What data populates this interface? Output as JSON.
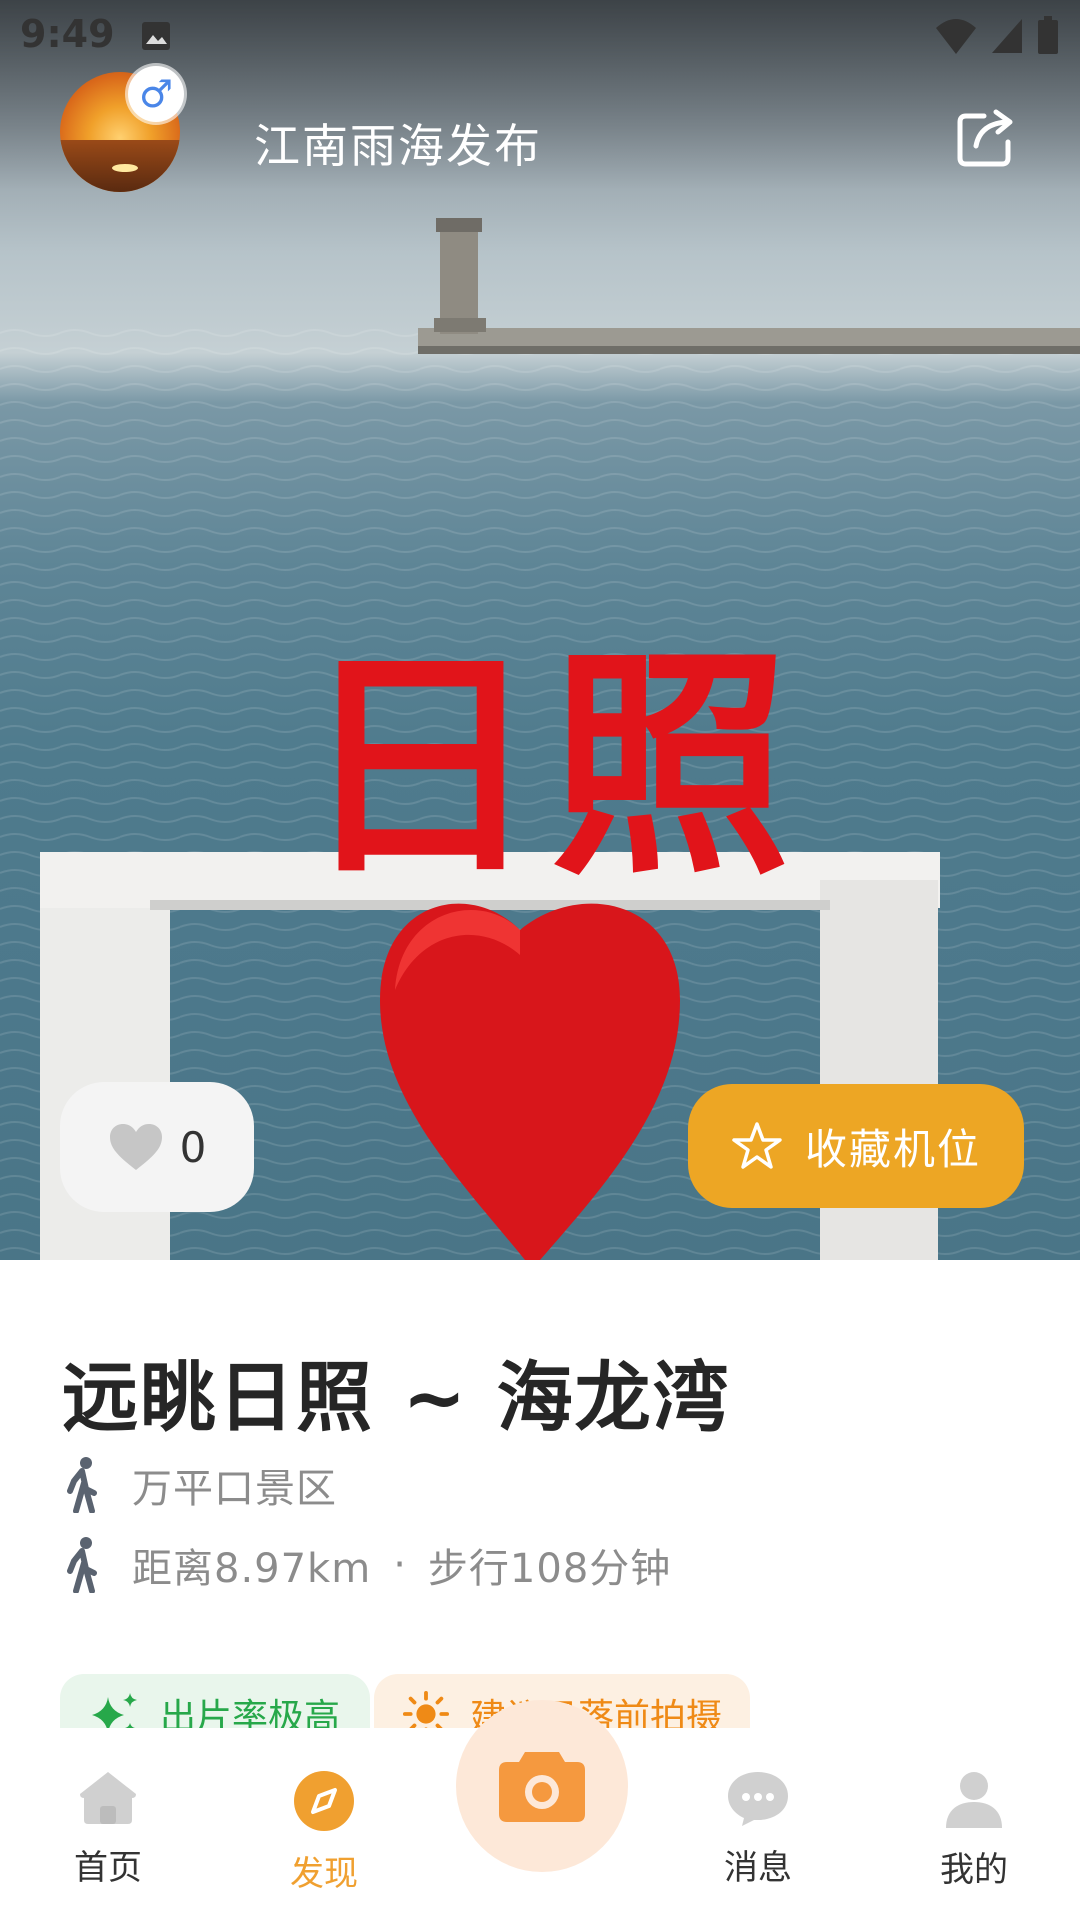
{
  "status_bar": {
    "time": "9:49"
  },
  "header": {
    "author_name": "江南雨海发布",
    "gender_symbol": "♂"
  },
  "photo": {
    "like_count": "0",
    "collect_label": "收藏机位",
    "sign_text": "日照"
  },
  "spot": {
    "title": "远眺日照 ~ 海龙湾",
    "area": "万平口景区",
    "distance": "距离8.97km",
    "separator": "·",
    "walk_time": "步行108分钟"
  },
  "tags": [
    {
      "label": "出片率极高",
      "icon": "sparkle-icon"
    },
    {
      "label": "建议日落前拍摄",
      "icon": "sun-icon"
    }
  ],
  "bottom_nav": {
    "items": [
      {
        "label": "首页",
        "icon": "home-icon"
      },
      {
        "label": "发现",
        "icon": "compass-icon",
        "active": true
      },
      {
        "label": "消息",
        "icon": "chat-icon"
      },
      {
        "label": "我的",
        "icon": "user-icon"
      }
    ],
    "center_icon": "camera-icon"
  },
  "colors": {
    "accent": "#eda624",
    "nav_active": "#f0a030",
    "tag_green": "#27a84a",
    "tag_orange": "#ef8a16"
  }
}
